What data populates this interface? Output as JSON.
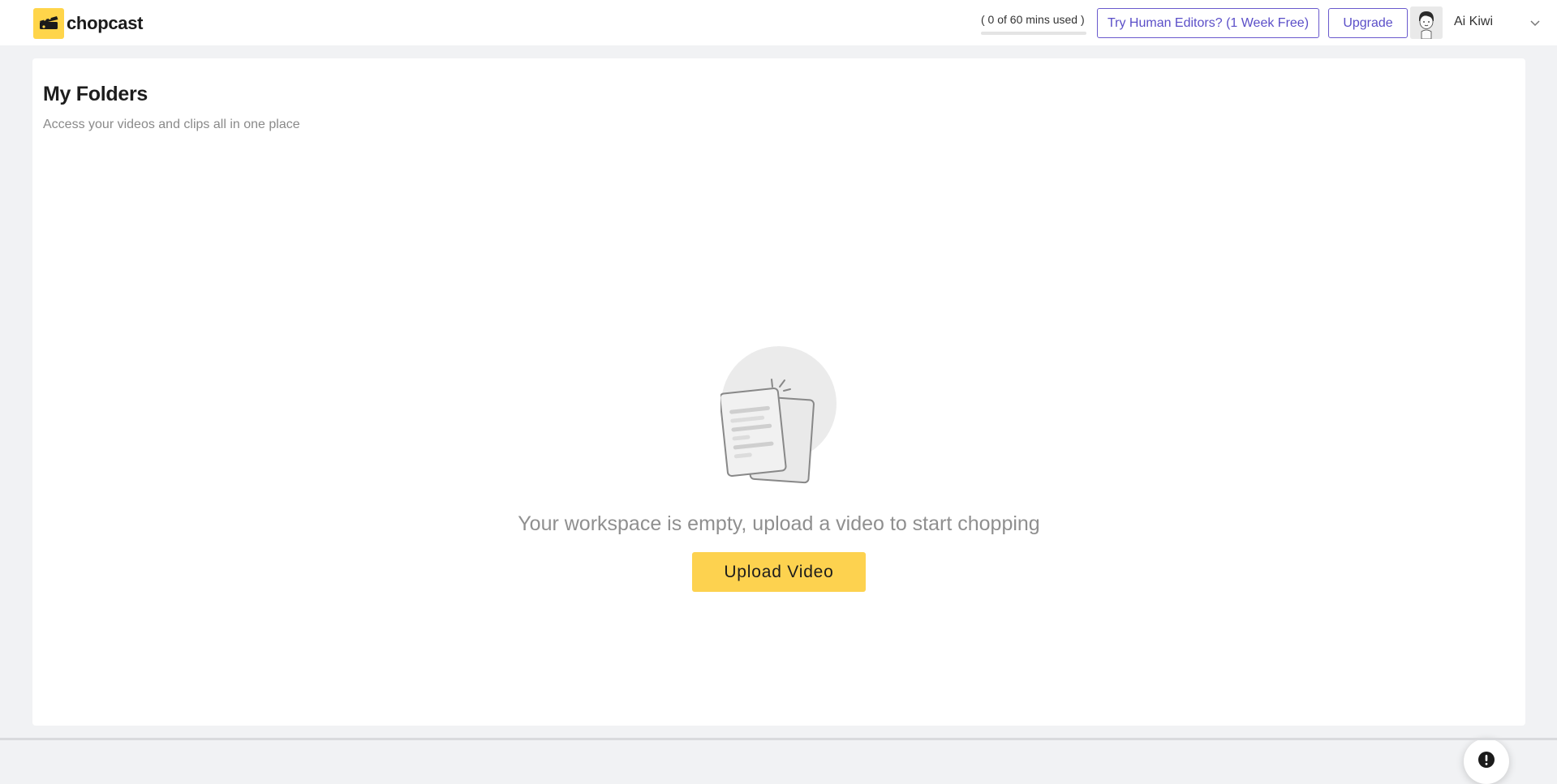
{
  "header": {
    "logo_text": "chopcast",
    "usage_text": "( 0 of 60 mins used )",
    "usage_fraction": 0.0,
    "try_human_label": "Try Human Editors? (1 Week Free)",
    "upgrade_label": "Upgrade",
    "user_name": "Ai Kiwi"
  },
  "main": {
    "title": "My Folders",
    "subtitle": "Access your videos and clips all in one place",
    "empty_message": "Your workspace is empty, upload a video to start chopping",
    "upload_label": "Upload Video"
  },
  "icons": {
    "logo": "chopcast-logo-icon",
    "avatar": "user-avatar",
    "chevron": "chevron-down-icon",
    "illustration": "empty-documents-illustration",
    "help": "exclamation-icon"
  },
  "colors": {
    "brand_yellow": "#fdd24f",
    "accent_purple": "#5b4fc8",
    "page_bg": "#f1f2f4"
  }
}
